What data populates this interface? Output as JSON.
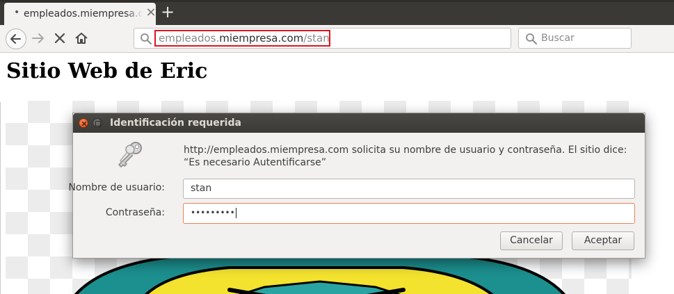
{
  "tabs": [
    {
      "title": "empleados.miempresa.com/stan",
      "active": true
    }
  ],
  "new_tab_symbol": "+",
  "toolbar": {
    "back_icon": "arrow-left-icon",
    "forward_icon": "arrow-right-icon",
    "stop_icon": "stop-x-icon",
    "home_icon": "home-icon",
    "url_prefix": "empleados.",
    "url_host": "miempresa.com",
    "url_path": "/stan",
    "url_highlight_color": "#e0141e",
    "search_placeholder": "Buscar"
  },
  "page": {
    "heading": "Sitio Web de Eric"
  },
  "dialog": {
    "title": "Identificación requerida",
    "message": "http://empleados.miempresa.com solicita su nombre de usuario y contraseña. El sitio dice: “Es necesario Autentificarse”",
    "username_label": "Nombre de usuario:",
    "username_value": "stan",
    "password_label": "Contraseña:",
    "password_value": "•••••••••",
    "cancel_label": "Cancelar",
    "accept_label": "Aceptar",
    "icon": "keys-icon"
  },
  "colors": {
    "tabstrip": "#3a3936",
    "dialog_title_bg": "#3b3a37",
    "close_button": "#d94d1c",
    "focus_border": "#e7835b"
  }
}
